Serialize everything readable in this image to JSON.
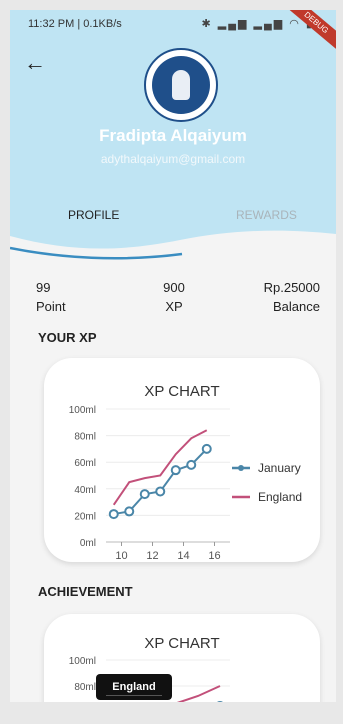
{
  "status_bar": {
    "time": "11:32 PM | 0.1KB/s",
    "ribbon": "DEBUG"
  },
  "profile": {
    "name": "Fradipta Alqaiyum",
    "email": "adythalqaiyum@gmail.com"
  },
  "tabs": [
    {
      "label": "PROFILE",
      "active": true
    },
    {
      "label": "REWARDS",
      "active": false
    }
  ],
  "stats": [
    {
      "value": "99",
      "label": "Point"
    },
    {
      "value": "900",
      "label": "XP"
    },
    {
      "value": "Rp.25000",
      "label": "Balance"
    }
  ],
  "sections": {
    "xp_title": "YOUR XP",
    "achievement_title": "ACHIEVEMENT"
  },
  "tooltip": {
    "label": "England"
  },
  "colors": {
    "header": "#bfe4f3",
    "january": "#4a86a8",
    "england": "#c2507a",
    "tab_underline": "#3a8dc1"
  },
  "chart_data": [
    {
      "type": "line",
      "title": "XP CHART",
      "xlim": [
        9,
        17
      ],
      "ylim": [
        0,
        100
      ],
      "x_ticks": [
        "10",
        "12",
        "14",
        "16"
      ],
      "y_ticks": [
        "0ml",
        "20ml",
        "40ml",
        "60ml",
        "80ml",
        "100ml"
      ],
      "legend": "right",
      "series": [
        {
          "name": "January",
          "marker": "circle",
          "x": [
            9.5,
            10.5,
            11.5,
            12.5,
            13.5,
            14.5,
            15.5
          ],
          "y": [
            21,
            23,
            36,
            38,
            54,
            58,
            70
          ]
        },
        {
          "name": "England",
          "marker": "none",
          "x": [
            9.5,
            10.5,
            11.5,
            12.5,
            13.5,
            14.5,
            15.5
          ],
          "y": [
            28,
            45,
            48,
            50,
            66,
            78,
            84
          ]
        }
      ]
    },
    {
      "type": "line",
      "title": "XP CHART",
      "ylim": [
        0,
        100
      ],
      "y_ticks": [
        "100ml",
        "80ml"
      ]
    }
  ]
}
